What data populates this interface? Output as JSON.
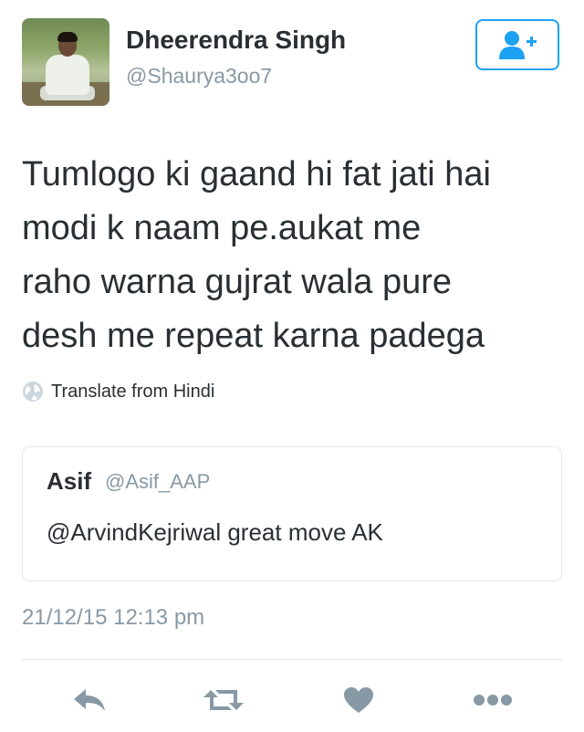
{
  "user": {
    "name": "Dheerendra Singh",
    "handle": "@Shaurya3oo7"
  },
  "follow_button": {
    "icon": "add-user-icon",
    "color": "#1da1f2"
  },
  "tweet": {
    "lines": [
      "Tumlogo ki gaand hi fat jati hai",
      "modi k naam pe.aukat me",
      "raho warna gujrat wala pure",
      "desh me repeat karna padega"
    ],
    "translate_label": "Translate from Hindi"
  },
  "quoted_tweet": {
    "name": "Asif",
    "handle": "@Asif_AAP",
    "text": "@ArvindKejriwal great move AK"
  },
  "timestamp": "21/12/15 12:13 pm",
  "actions": [
    "reply-icon",
    "retweet-icon",
    "like-icon",
    "more-icon"
  ],
  "colors": {
    "muted": "#8899a6",
    "text": "#292f33",
    "accent": "#1da1f2",
    "border": "#e1e8ed"
  }
}
